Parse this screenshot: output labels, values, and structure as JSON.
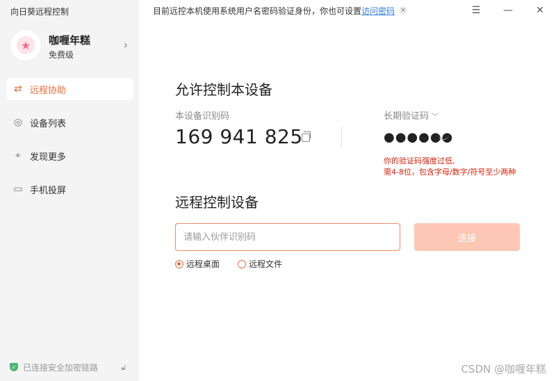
{
  "app": {
    "title": "向日葵远程控制"
  },
  "profile": {
    "name": "咖喱年糕",
    "level": "免费级"
  },
  "nav": {
    "items": [
      {
        "label": "远程协助",
        "icon": "remote-assist-icon",
        "active": true
      },
      {
        "label": "设备列表",
        "icon": "device-list-icon",
        "active": false
      },
      {
        "label": "发现更多",
        "icon": "discover-icon",
        "active": false
      },
      {
        "label": "手机投屏",
        "icon": "screen-cast-icon",
        "active": false
      }
    ]
  },
  "security": {
    "status": "已连接安全加密链路"
  },
  "notice": {
    "text": "目前远控本机使用系统用户名密码验证身份，你也可设置",
    "link": "访问密码"
  },
  "allow": {
    "title": "允许控制本设备",
    "device_code_label": "本设备识别码",
    "device_code": "169 941 825",
    "password_label": "长期验证码",
    "password_mask": "●●●●●●",
    "warning_line1": "你的验证码强度过低,",
    "warning_line2": "需4-8位，包含字母/数字/符号至少两种"
  },
  "remote": {
    "title": "远程控制设备",
    "input_placeholder": "请输入伙伴识别码",
    "connect_label": "连接",
    "options": [
      {
        "label": "远程桌面",
        "checked": true
      },
      {
        "label": "远程文件",
        "checked": false
      }
    ]
  },
  "watermark": "CSDN @咖喱年糕",
  "colors": {
    "accent": "#ec6b3d",
    "warning": "#d81e06",
    "link": "#2f7fe0",
    "button_disabled": "#fcc7b4"
  }
}
